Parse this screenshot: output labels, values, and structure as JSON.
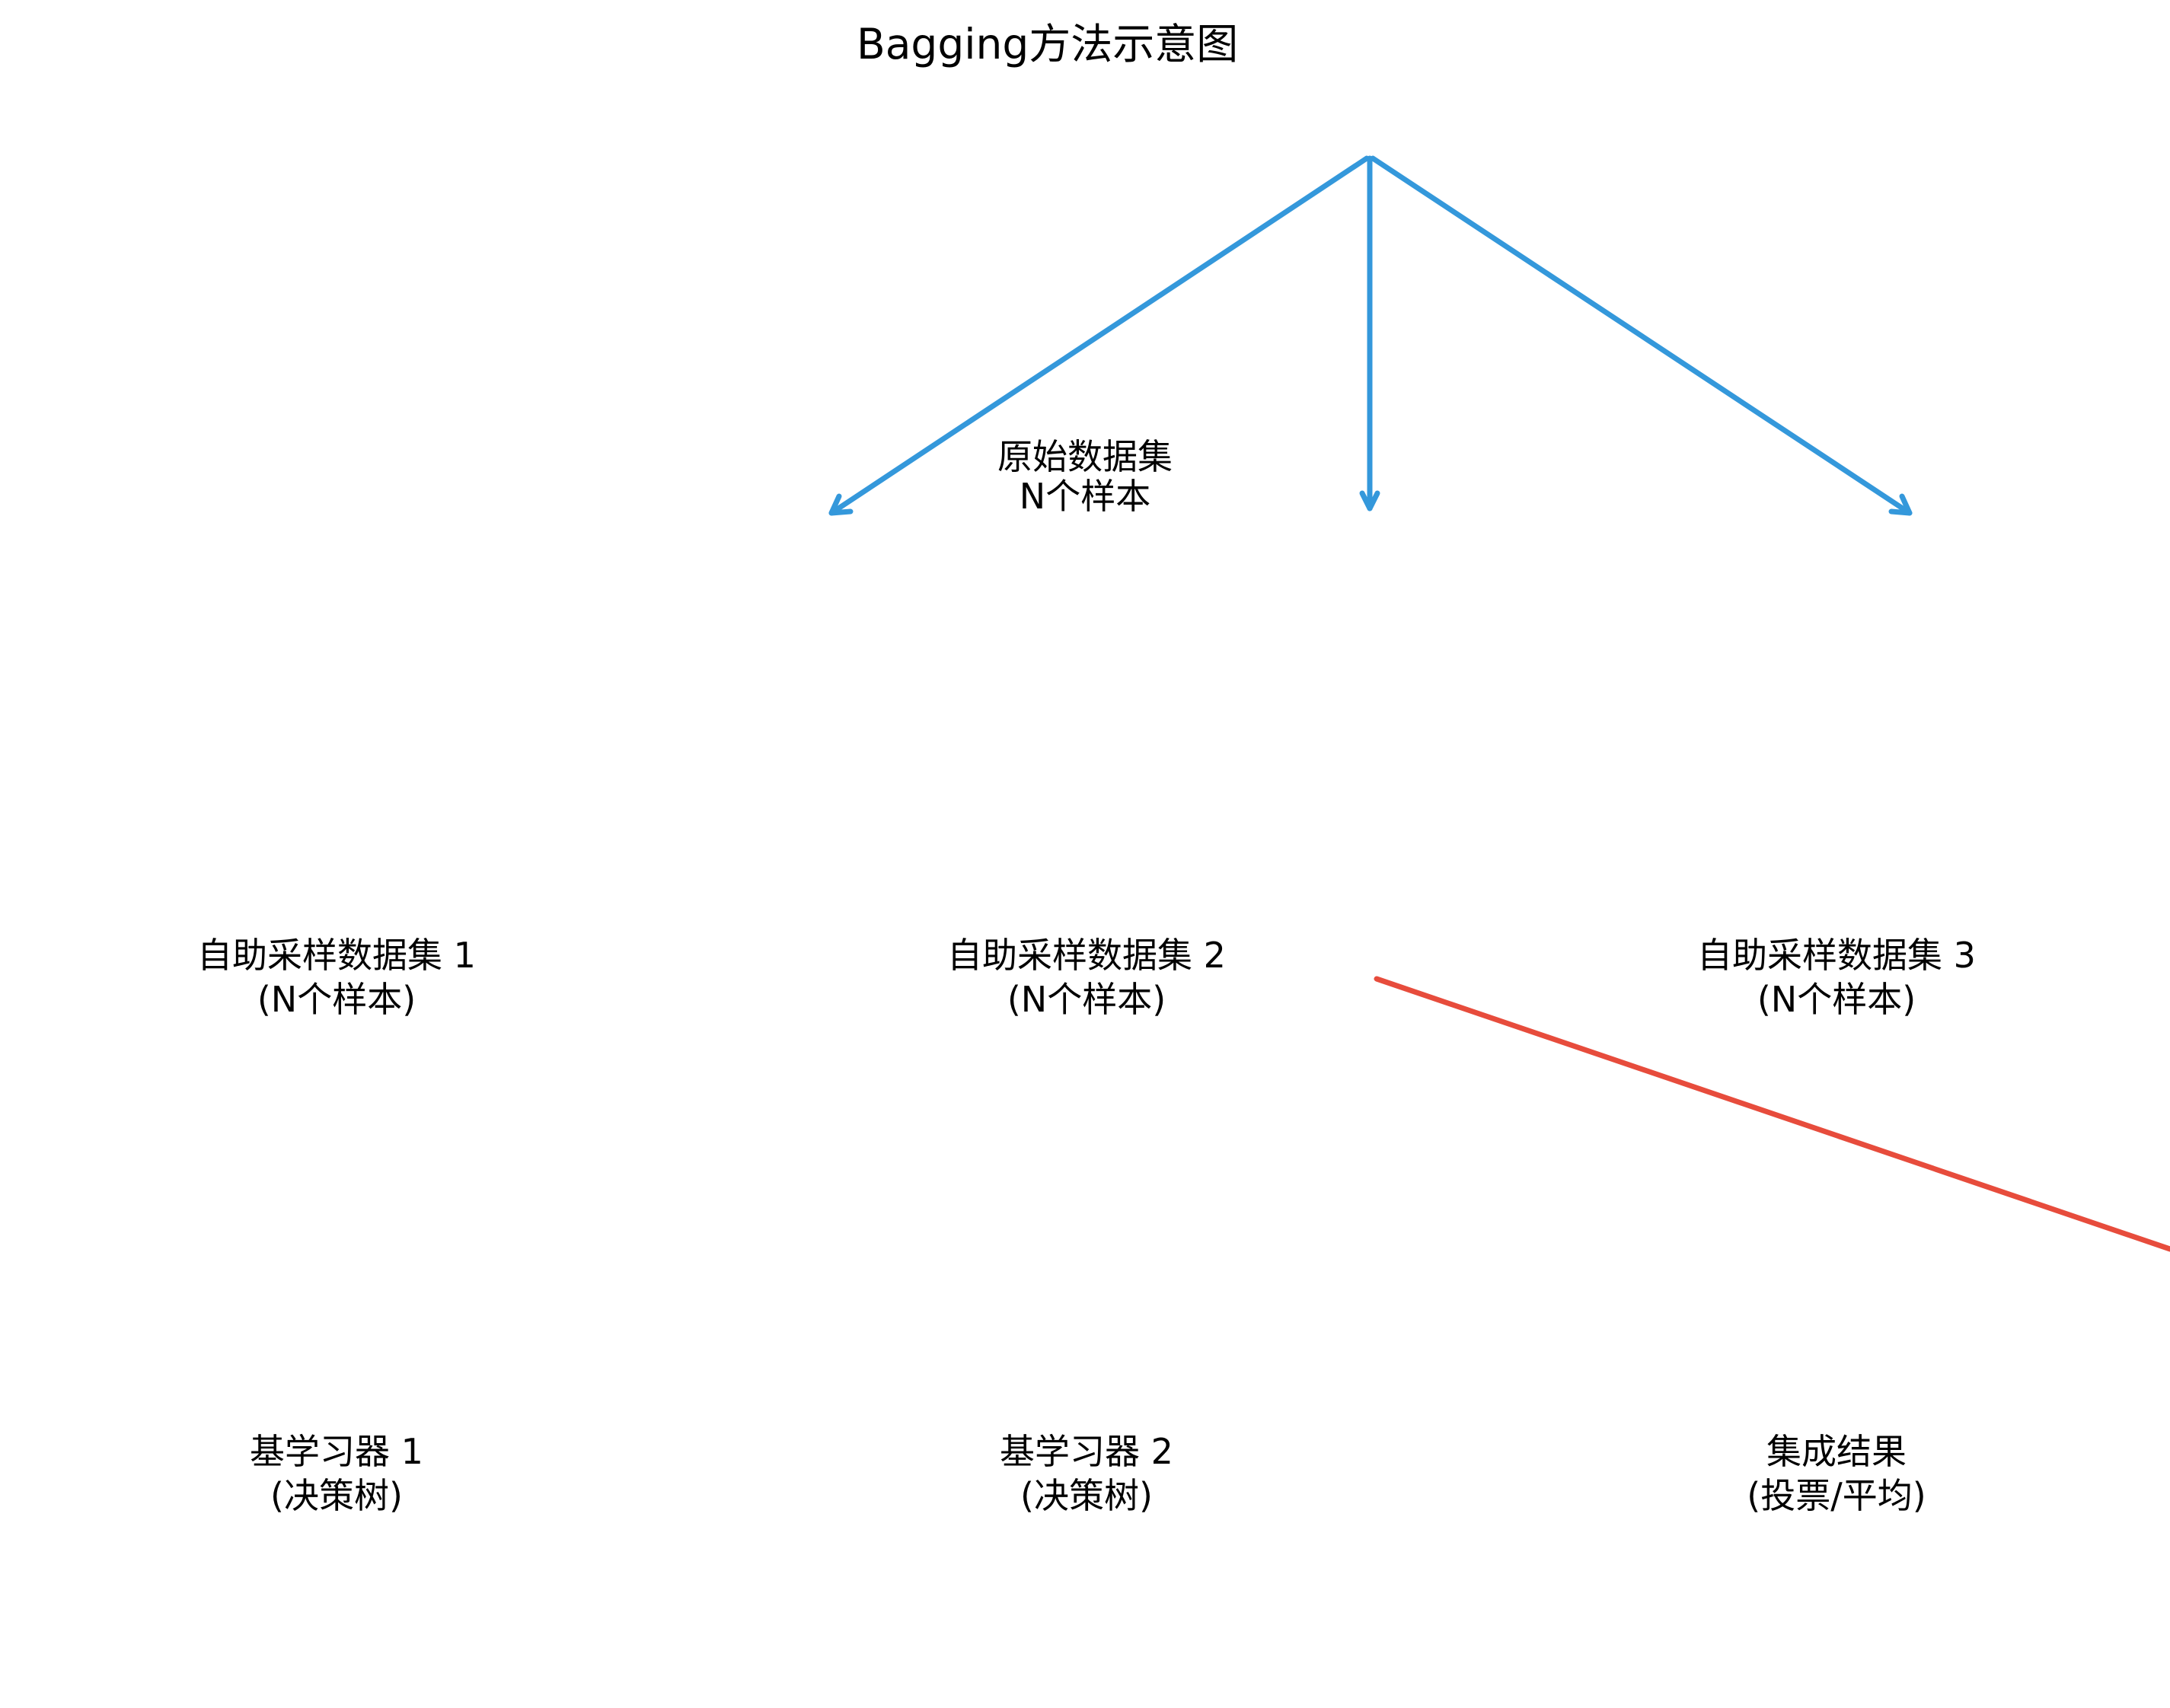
{
  "title": "Bagging方法示意图",
  "original_dataset": {
    "line1": "原始数据集",
    "line2": "N个样本"
  },
  "bootstrap_datasets": [
    {
      "line1": "自助采样数据集 1",
      "line2": "(N个样本)"
    },
    {
      "line1": "自助采样数据集 2",
      "line2": "(N个样本)"
    },
    {
      "line1": "自助采样数据集 3",
      "line2": "(N个样本)"
    }
  ],
  "learners": [
    {
      "line1": "基学习器 1",
      "line2": "(决策树)"
    },
    {
      "line1": "基学习器 2",
      "line2": "(决策树)"
    }
  ],
  "result": {
    "line1": "集成结果",
    "line2": "(投票/平均)"
  },
  "colors": {
    "sampling_arrow": "#3498db",
    "aggregation_arrow": "#e74c3c",
    "text": "#000000",
    "background": "#ffffff"
  }
}
